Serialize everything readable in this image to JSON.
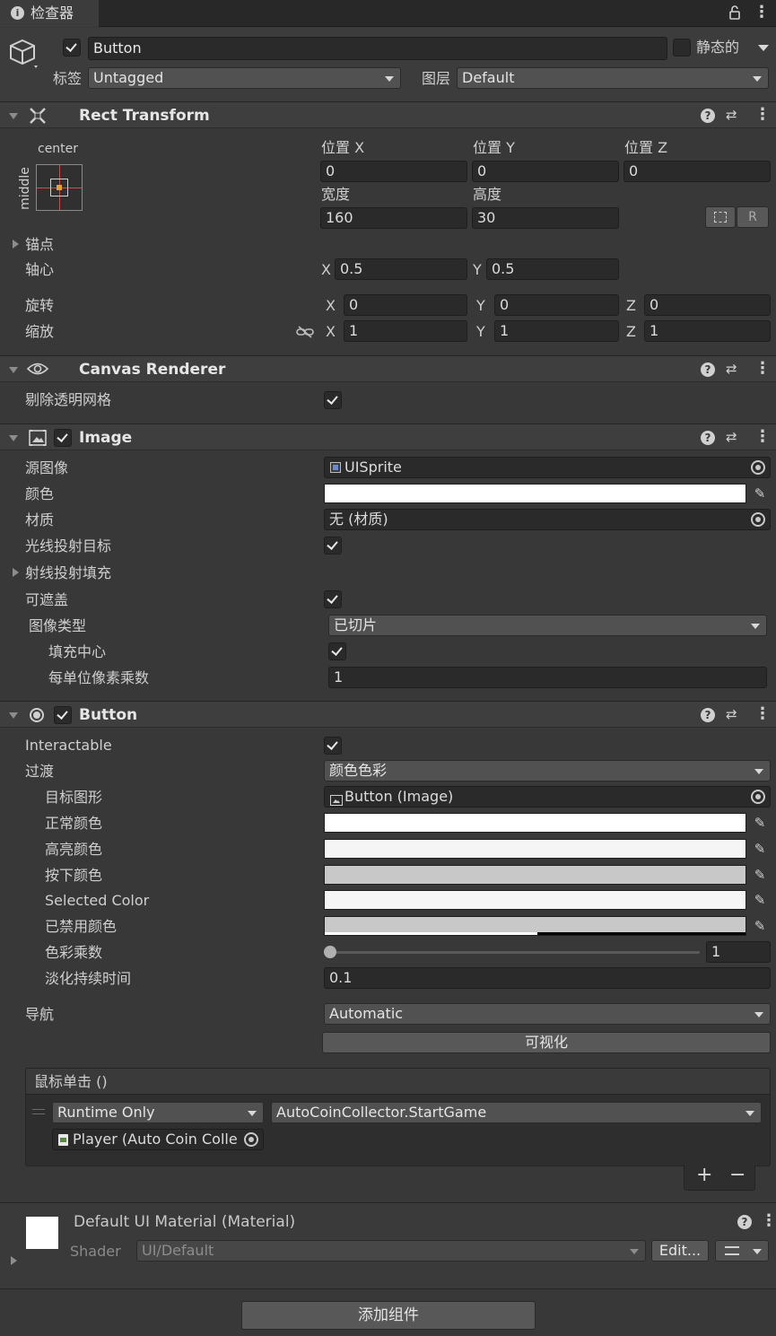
{
  "tab": {
    "label": "检查器"
  },
  "object": {
    "name": "Button",
    "static_label": "静态的",
    "tag_label": "标签",
    "tag_value": "Untagged",
    "layer_label": "图层",
    "layer_value": "Default"
  },
  "rect_transform": {
    "title": "Rect Transform",
    "anchor_h": "center",
    "anchor_v": "middle",
    "pos_x_label": "位置 X",
    "pos_y_label": "位置 Y",
    "pos_z_label": "位置 Z",
    "pos_x": "0",
    "pos_y": "0",
    "pos_z": "0",
    "width_label": "宽度",
    "height_label": "高度",
    "width": "160",
    "height": "30",
    "r_label": "R",
    "anchors_label": "锚点",
    "pivot_label": "轴心",
    "pivot_x": "0.5",
    "pivot_y": "0.5",
    "rotation_label": "旋转",
    "rot_x": "0",
    "rot_y": "0",
    "rot_z": "0",
    "scale_label": "缩放",
    "scale_x": "1",
    "scale_y": "1",
    "scale_z": "1",
    "x": "X",
    "y": "Y",
    "z": "Z"
  },
  "canvas_renderer": {
    "title": "Canvas Renderer",
    "cull_label": "剔除透明网格"
  },
  "image": {
    "title": "Image",
    "source_label": "源图像",
    "source_value": "UISprite",
    "color_label": "颜色",
    "color_value": "#FFFFFF",
    "material_label": "材质",
    "material_value": "无 (材质)",
    "raycast_target_label": "光线投射目标",
    "raycast_padding_label": "射线投射填充",
    "maskable_label": "可遮盖",
    "image_type_label": "图像类型",
    "image_type_value": "已切片",
    "fill_center_label": "填充中心",
    "ppu_label": "每单位像素乘数",
    "ppu_value": "1"
  },
  "button": {
    "title": "Button",
    "interactable_label": "Interactable",
    "transition_label": "过渡",
    "transition_value": "颜色色彩",
    "target_graphic_label": "目标图形",
    "target_graphic_value": "Button (Image)",
    "normal_label": "正常颜色",
    "highlighted_label": "高亮颜色",
    "pressed_label": "按下颜色",
    "selected_label": "Selected Color",
    "disabled_label": "已禁用颜色",
    "normal_color": "#FFFFFF",
    "highlighted_color": "#F5F5F5",
    "pressed_color": "#C8C8C8",
    "selected_color": "#F5F5F5",
    "disabled_color": "#C8C8C8",
    "multiplier_label": "色彩乘数",
    "multiplier_value": "1",
    "fade_label": "淡化持续时间",
    "fade_value": "0.1",
    "nav_label": "导航",
    "nav_value": "Automatic",
    "visualize_label": "可视化",
    "onclick_label": "鼠标单击 ()",
    "runtime_value": "Runtime Only",
    "function_value": "AutoCoinCollector.StartGame",
    "target_value": "Player (Auto Coin Colle",
    "add_label": "+",
    "remove_label": "−"
  },
  "material": {
    "name": "Default UI Material (Material)",
    "shader_label": "Shader",
    "shader_value": "UI/Default",
    "edit_label": "Edit..."
  },
  "add_component_label": "添加组件"
}
